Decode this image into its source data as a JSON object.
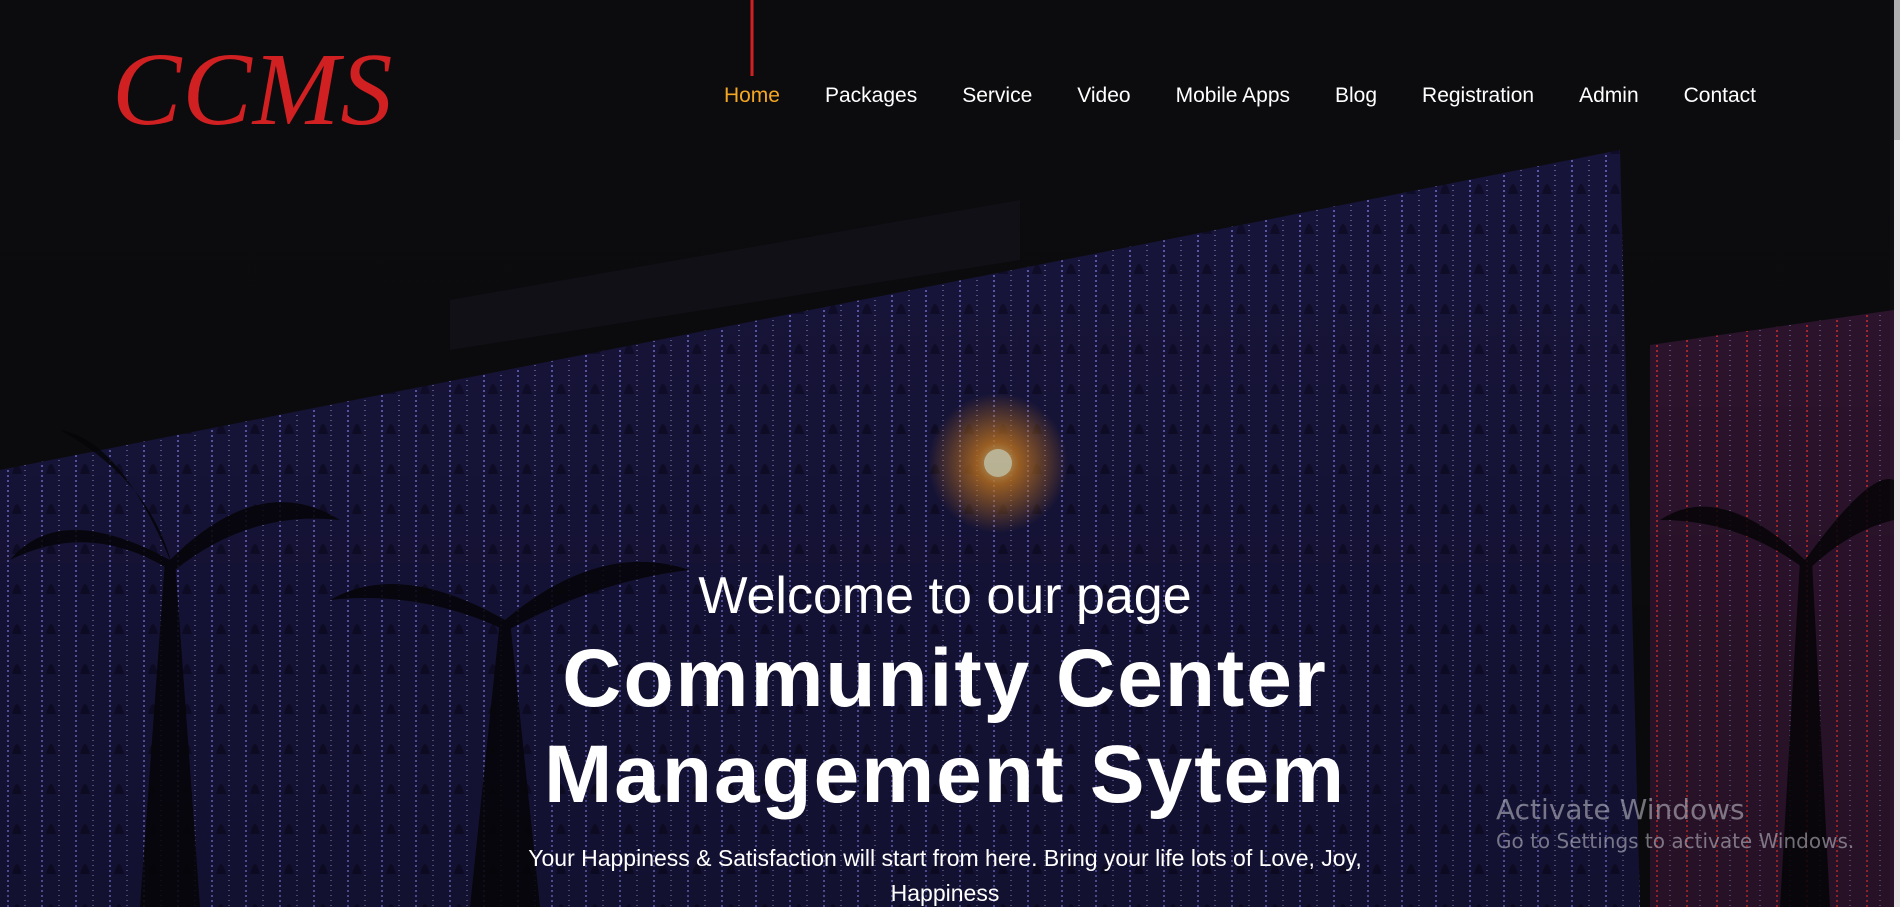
{
  "brand": {
    "logo_text": "CCMS",
    "logo_color": "#d12021"
  },
  "nav": {
    "items": [
      {
        "label": "Home",
        "active": true
      },
      {
        "label": "Packages"
      },
      {
        "label": "Service"
      },
      {
        "label": "Video"
      },
      {
        "label": "Mobile Apps"
      },
      {
        "label": "Blog"
      },
      {
        "label": "Registration"
      },
      {
        "label": "Admin"
      },
      {
        "label": "Contact"
      }
    ],
    "active_color": "#f5a623"
  },
  "hero": {
    "welcome": "Welcome to our page",
    "title": "Community Center Management Sytem",
    "tagline": "Your Happiness & Satisfaction will start from here. Bring your life lots of Love, Joy, Happiness"
  },
  "watermark": {
    "line1": "Activate Windows",
    "line2": "Go to Settings to activate Windows."
  }
}
